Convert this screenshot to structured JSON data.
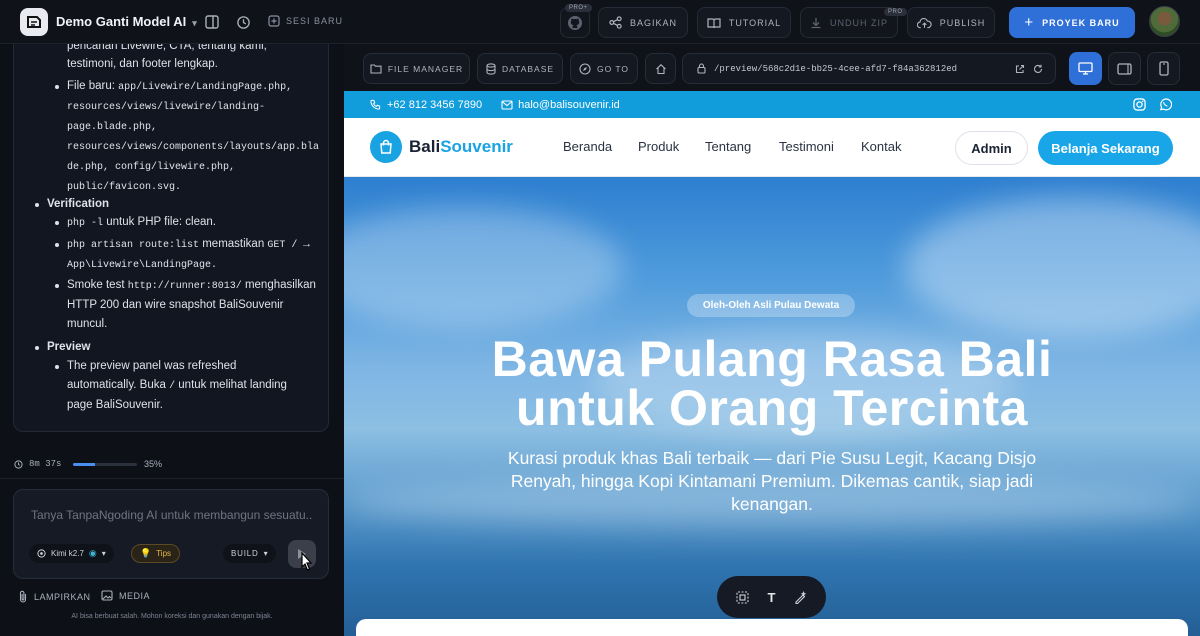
{
  "topbar": {
    "project_title": "Demo Ganti Model AI",
    "sesi_baru": "SESI BARU",
    "pro_plus": "PRO+",
    "bagikan": "BAGIKAN",
    "tutorial": "TUTORIAL",
    "unduh_zip": "UNDUH ZIP",
    "pro": "PRO",
    "publish": "PUBLISH",
    "proyek_baru": "PROYEK BARU"
  },
  "chat": {
    "line_top": "pencarian Livewire, CTA, tentang kami,",
    "line_top2": "testimoni, dan footer lengkap.",
    "file_baru_label": "File baru: ",
    "file_baru_paths": [
      "app/Livewire/LandingPage.php,",
      "resources/views/livewire/landing-",
      "page.blade.php,",
      "resources/views/components/layouts/app.bla",
      "de.php, config/livewire.php,",
      "public/favicon.svg."
    ],
    "verification_title": "Verification",
    "v1_code": "php -l",
    "v1_text": " untuk PHP file: clean.",
    "v2_code": "php artisan route:list",
    "v2_text": " memastikan ",
    "v2_code2": "GET /",
    "v2_arrow": " →",
    "v2_code3": "App\\Livewire\\LandingPage.",
    "v3_text": "Smoke test ",
    "v3_code": "http://runner:8013/",
    "v3_text2": " menghasilkan",
    "v3_line2": "HTTP 200 dan wire snapshot BaliSouvenir",
    "v3_line3": "muncul.",
    "preview_title": "Preview",
    "p1_line1": "The preview panel was refreshed",
    "p1_line2a": "automatically. Buka ",
    "p1_code": "/",
    "p1_line2b": " untuk melihat landing",
    "p1_line3": "page BaliSouvenir."
  },
  "status": {
    "timer": "8m 37s",
    "progress": 0.35,
    "progress_label": "35%"
  },
  "input": {
    "placeholder": "Tanya TanpaNgoding AI untuk membangun sesuatu...",
    "model": "Kimi k2.7",
    "tips": "Tips",
    "mode": "BUILD"
  },
  "attach": {
    "lampirkan": "LAMPIRKAN",
    "media": "MEDIA",
    "disclaimer": "AI bisa berbuat salah. Mohon koreksi dan gunakan dengan bijak."
  },
  "toolbar": {
    "file_manager": "FILE MANAGER",
    "database": "DATABASE",
    "go_to": "GO TO",
    "url": "/preview/568c2d1e-bb25-4cee-afd7-f84a362812ed"
  },
  "site": {
    "phone": "+62 812 3456 7890",
    "email": "halo@balisouvenir.id",
    "brand_a": "Bali",
    "brand_b": "Souvenir",
    "nav": [
      "Beranda",
      "Produk",
      "Tentang",
      "Testimoni",
      "Kontak"
    ],
    "admin": "Admin",
    "cta": "Belanja Sekarang",
    "pill": "Oleh-Oleh Asli Pulau Dewata",
    "h1_line1": "Bawa Pulang Rasa Bali",
    "h1_line2": "untuk Orang Tercinta",
    "sub": "Kurasi produk khas Bali terbaik — dari Pie Susu Legit, Kacang Disjo Renyah, hingga Kopi Kintamani Premium. Dikemas cantik, siap jadi kenangan."
  },
  "floatbar": {
    "text_tool": "T"
  },
  "colors": {
    "accent": "#2f6fd8",
    "brand": "#1aa3e3",
    "bg": "#0d1017"
  }
}
